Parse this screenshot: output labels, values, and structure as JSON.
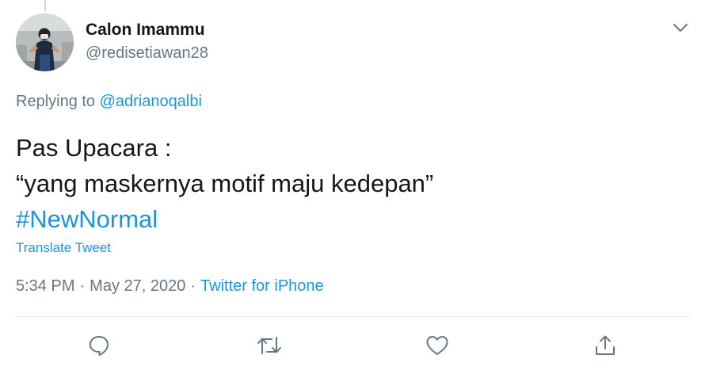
{
  "user": {
    "display_name": "Calon Imammu",
    "handle": "@redisetiawan28",
    "avatar_icon": "user-avatar-photo"
  },
  "reply": {
    "prefix": "Replying to ",
    "mention": "@adrianoqalbi"
  },
  "tweet": {
    "line1": "Pas Upacara :",
    "line2": "“yang maskernya motif maju kedepan”",
    "hashtag": "#NewNormal",
    "translate_label": "Translate Tweet"
  },
  "meta": {
    "time": "5:34 PM",
    "separator": "·",
    "date": "May 27, 2020",
    "source": "Twitter for iPhone"
  },
  "icons": {
    "more": "chevron-down-icon",
    "reply": "reply-icon",
    "retweet": "retweet-icon",
    "like": "heart-icon",
    "share": "share-icon"
  },
  "colors": {
    "link": "#1b95e0",
    "secondary_text": "#657786",
    "primary_text": "#14171a",
    "divider": "#e6ecf0"
  }
}
